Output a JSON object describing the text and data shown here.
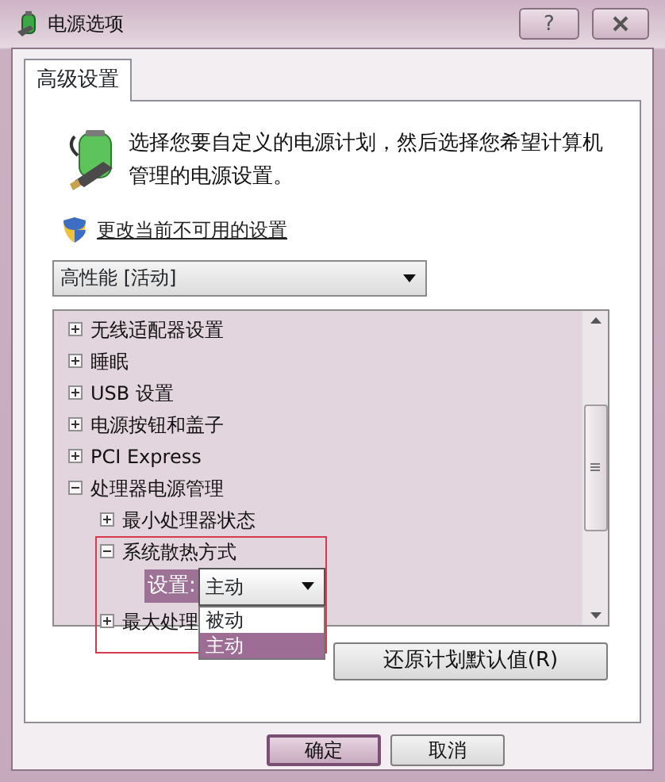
{
  "window": {
    "title": "电源选项",
    "help_button": "?"
  },
  "tabs": [
    {
      "label": "高级设置",
      "selected": true
    }
  ],
  "intro": "选择您要自定义的电源计划，然后选择您希望计算机管理的电源设置。",
  "change_link": "更改当前不可用的设置",
  "plan_select": {
    "value": "高性能 [活动]"
  },
  "settings_tree": [
    {
      "label": "无线适配器设置",
      "expanded": false
    },
    {
      "label": "睡眠",
      "expanded": false
    },
    {
      "label": "USB 设置",
      "expanded": false
    },
    {
      "label": "电源按钮和盖子",
      "expanded": false
    },
    {
      "label": "PCI Express",
      "expanded": false
    },
    {
      "label": "处理器电源管理",
      "expanded": true,
      "children": [
        {
          "label": "最小处理器状态",
          "expanded": false
        },
        {
          "label": "系统散热方式",
          "expanded": true,
          "highlighted": true,
          "setting": {
            "label": "设置:",
            "value": "主动",
            "open": true,
            "options": [
              {
                "label": "被动",
                "selected": false
              },
              {
                "label": "主动",
                "selected": true
              }
            ]
          }
        },
        {
          "label": "最大处理",
          "expanded": false
        }
      ]
    }
  ],
  "restore_button": "还原计划默认值(R)",
  "buttons": [
    {
      "label": "确定",
      "default": true
    },
    {
      "label": "取消",
      "default": false
    }
  ]
}
